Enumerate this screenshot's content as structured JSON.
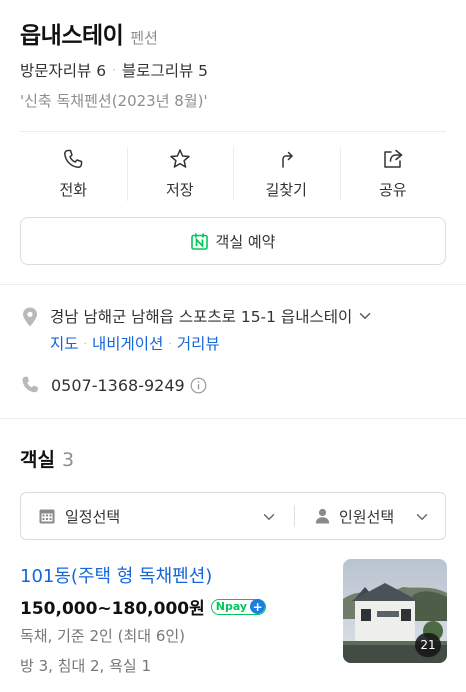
{
  "place": {
    "name": "읍내스테이",
    "category": "펜션",
    "visitor_reviews": "방문자리뷰 6",
    "blog_reviews": "블로그리뷰 5",
    "separator": "·",
    "tagline": "'신축 독채펜션(2023년 8월)'"
  },
  "actions": [
    {
      "label": "전화",
      "icon": "phone-icon"
    },
    {
      "label": "저장",
      "icon": "star-icon"
    },
    {
      "label": "길찾기",
      "icon": "directions-icon"
    },
    {
      "label": "공유",
      "icon": "share-icon"
    }
  ],
  "reserve": {
    "label": "객실 예약",
    "icon": "naver-booking-icon"
  },
  "address": {
    "text": "경남 남해군 남해읍 스포츠로 15-1 읍내스테이",
    "links": [
      "지도",
      "내비게이션",
      "거리뷰"
    ],
    "link_separator": "·"
  },
  "phone": {
    "number": "0507-1368-9249"
  },
  "rooms": {
    "title": "객실",
    "count": "3",
    "filter": {
      "date_label": "일정선택",
      "guest_label": "인원선택"
    },
    "items": [
      {
        "name": "101동(주택 형 독채펜션)",
        "price": "150,000~180,000원",
        "npay": "pay",
        "npay_plus": "+",
        "meta1": "독채, 기준 2인 (최대 6인)",
        "meta2": "방 3, 침대 2, 욕실 1",
        "photo_count": "21"
      }
    ]
  },
  "colors": {
    "link": "#1766d9",
    "naver_green": "#03c75a",
    "muted": "#8e8e8e"
  }
}
